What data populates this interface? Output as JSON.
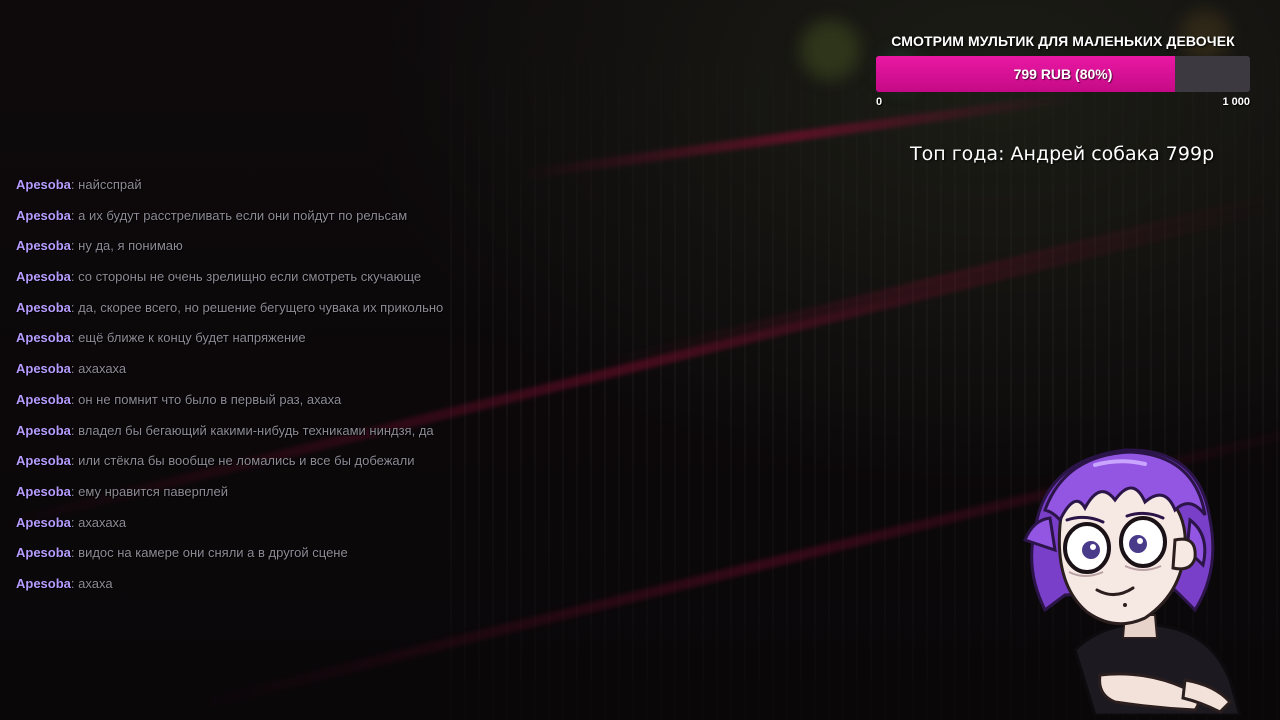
{
  "goal": {
    "title": "СМОТРИМ МУЛЬТИК ДЛЯ МАЛЕНЬКИХ ДЕВОЧЕК",
    "amount_label": "799 RUB (80%)",
    "progress_fraction": 0.8,
    "min_label": "0",
    "max_label": "1 000",
    "fill_color": "#e0179c"
  },
  "top_donator": {
    "text": "Топ года: Андрей собака 799р"
  },
  "chat": {
    "messages": [
      {
        "user": "Apesoba",
        "text": "найсспрай"
      },
      {
        "user": "Apesoba",
        "text": "а их будут расстреливать если они пойдут по рельсам"
      },
      {
        "user": "Apesoba",
        "text": "ну да, я понимаю"
      },
      {
        "user": "Apesoba",
        "text": "со стороны не очень зрелищно если смотреть скучающе"
      },
      {
        "user": "Apesoba",
        "text": "да, скорее всего, но решение бегущего чувака их прикольно"
      },
      {
        "user": "Apesoba",
        "text": "ещё ближе к концу будет напряжение"
      },
      {
        "user": "Apesoba",
        "text": "ахахаха"
      },
      {
        "user": "Apesoba",
        "text": "он не помнит что было в первый раз, ахаха"
      },
      {
        "user": "Apesoba",
        "text": "владел бы бегающий какими-нибудь техниками ниндзя, да"
      },
      {
        "user": "Apesoba",
        "text": "или стёкла бы вообще не ломались и все бы добежали"
      },
      {
        "user": "Apesoba",
        "text": "ему нравится паверплей"
      },
      {
        "user": "Apesoba",
        "text": "ахахаха"
      },
      {
        "user": "Apesoba",
        "text": "видос на камере они сняли а в другой сцене"
      },
      {
        "user": "Apesoba",
        "text": "ахаха"
      }
    ],
    "separator": ":",
    "username_color": "#b79cff",
    "message_color": "#8f8a95"
  },
  "avatar": {
    "icon": "purple-haired-vtuber-avatar",
    "hair_color": "#8a4fd6"
  }
}
